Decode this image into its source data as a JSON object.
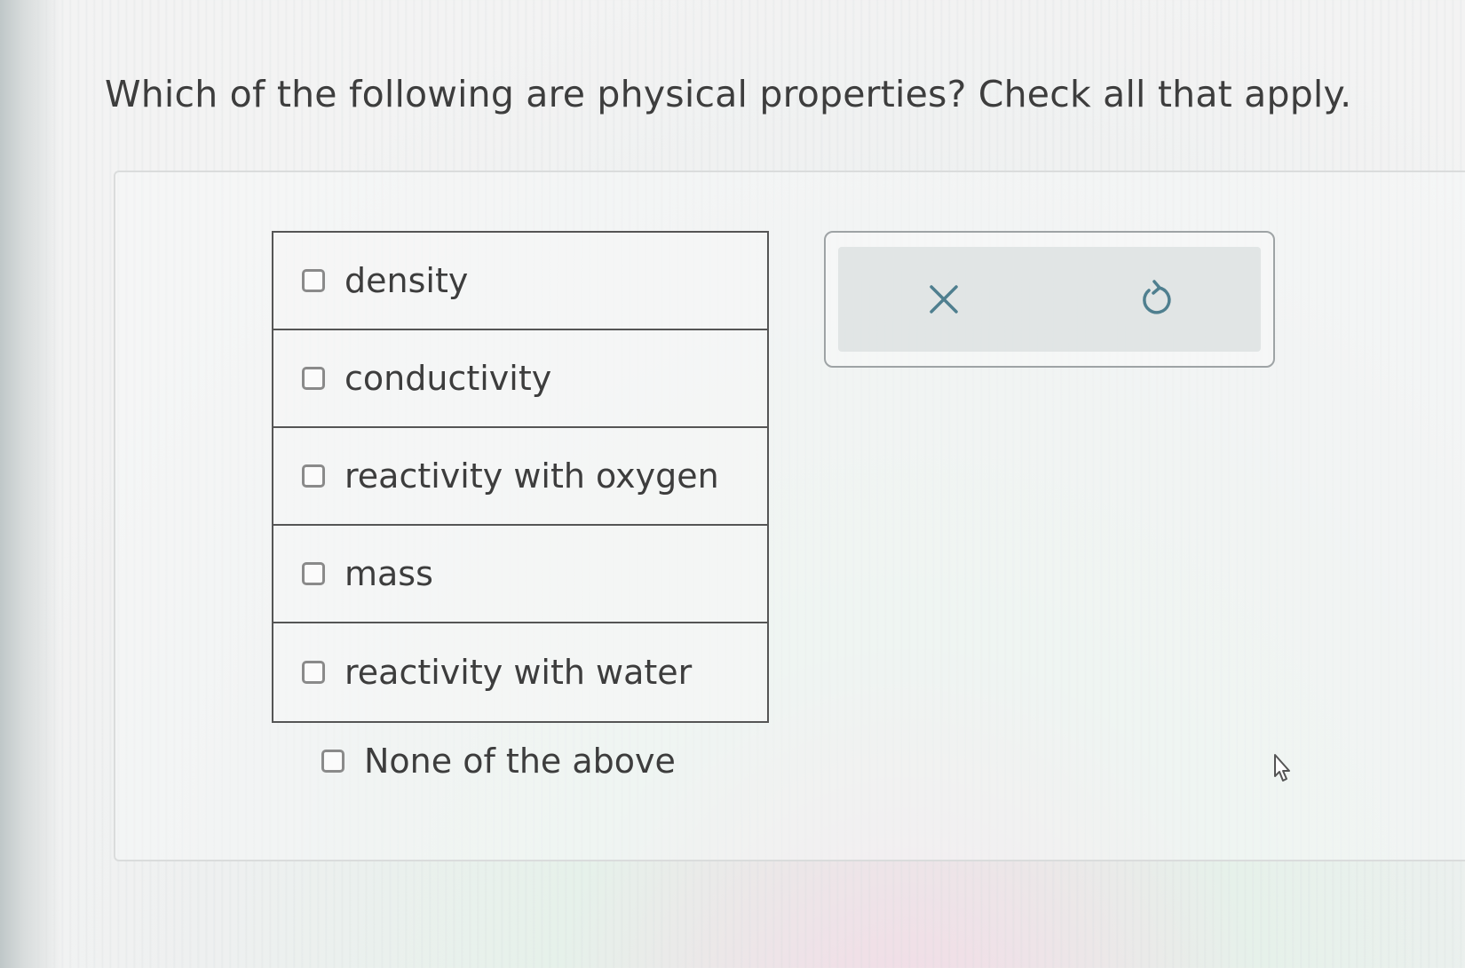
{
  "question": {
    "text": "Which of the following are physical properties? Check all that apply."
  },
  "options": [
    {
      "label": "density",
      "checked": false
    },
    {
      "label": "conductivity",
      "checked": false
    },
    {
      "label": "reactivity with oxygen",
      "checked": false
    },
    {
      "label": "mass",
      "checked": false
    },
    {
      "label": "reactivity with water",
      "checked": false
    }
  ],
  "none_option": {
    "label": "None of the above",
    "checked": false
  },
  "actions": {
    "clear_icon": "close-icon",
    "reset_icon": "undo-icon"
  },
  "colors": {
    "text": "#3d3d3d",
    "border": "#555555",
    "icon": "#4f7f8f"
  }
}
